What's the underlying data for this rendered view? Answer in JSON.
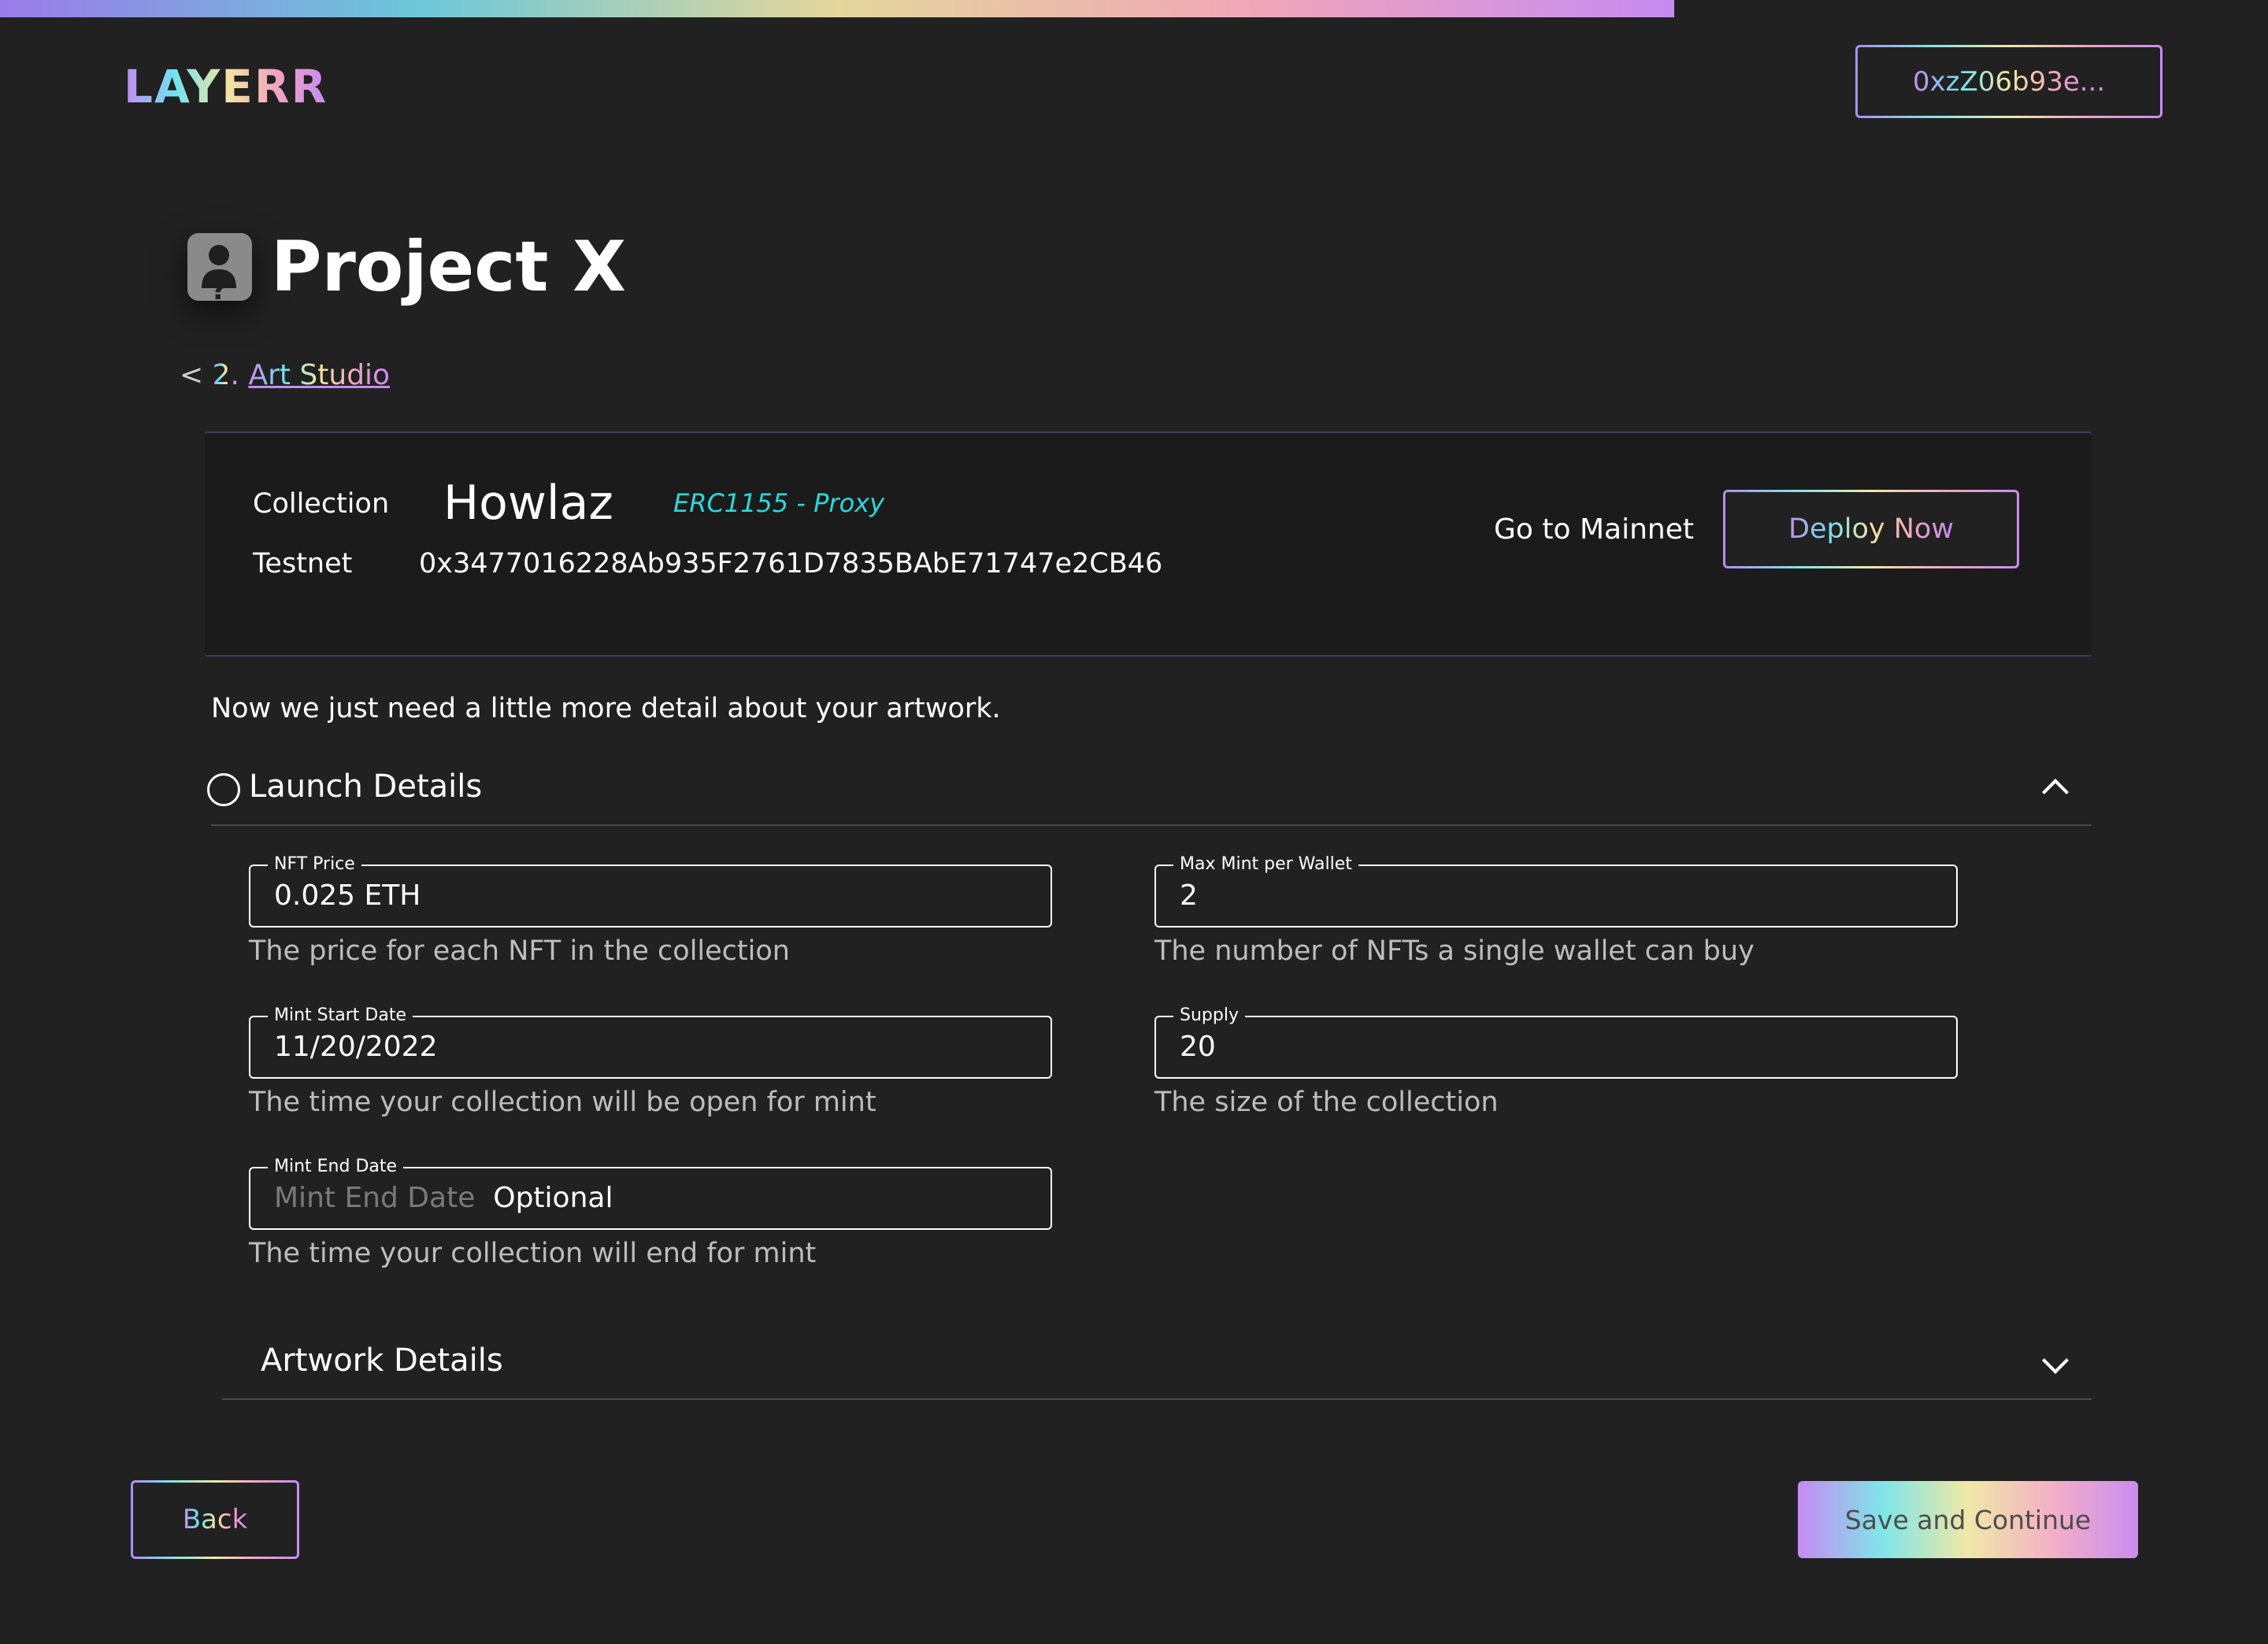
{
  "header": {
    "logo_text": "LAYERR",
    "wallet_label": "0xzZ06b93e..."
  },
  "project": {
    "title": "Project X",
    "breadcrumb_prefix": "<",
    "breadcrumb_step": "2.",
    "breadcrumb_link": "Art Studio"
  },
  "collection_card": {
    "collection_label": "Collection",
    "collection_name": "Howlaz",
    "contract_type": "ERC1155 - Proxy",
    "network_label": "Testnet",
    "contract_address": "0x3477016228Ab935F2761D7835BAbE71747e2CB46",
    "mainnet_label": "Go to Mainnet",
    "deploy_label": "Deploy Now"
  },
  "intro_text": "Now we just need a little more detail about your artwork.",
  "launch_details": {
    "title": "Launch Details",
    "expanded": true,
    "fields": {
      "nft_price": {
        "label": "NFT Price",
        "value": "0.025 ETH",
        "help": "The price for each NFT in the collection"
      },
      "max_mint": {
        "label": "Max Mint per Wallet",
        "value": "2",
        "help": "The number of NFTs a single wallet can buy"
      },
      "mint_start": {
        "label": "Mint Start Date",
        "value": "11/20/2022",
        "help": "The time your collection will be open for mint"
      },
      "supply": {
        "label": "Supply",
        "value": "20",
        "help": "The size of the collection"
      },
      "mint_end": {
        "label": "Mint End Date",
        "placeholder": "Mint End Date",
        "suffix": "Optional",
        "help": "The time your collection will end for mint"
      }
    }
  },
  "artwork_details": {
    "title": "Artwork Details",
    "expanded": false
  },
  "footer": {
    "back_label": "Back",
    "save_label": "Save and Continue"
  },
  "colors": {
    "background": "#212121",
    "card": "#1b1b1b",
    "accent_cyan": "#2cd8d8",
    "accent_purple": "#c58bf2"
  }
}
